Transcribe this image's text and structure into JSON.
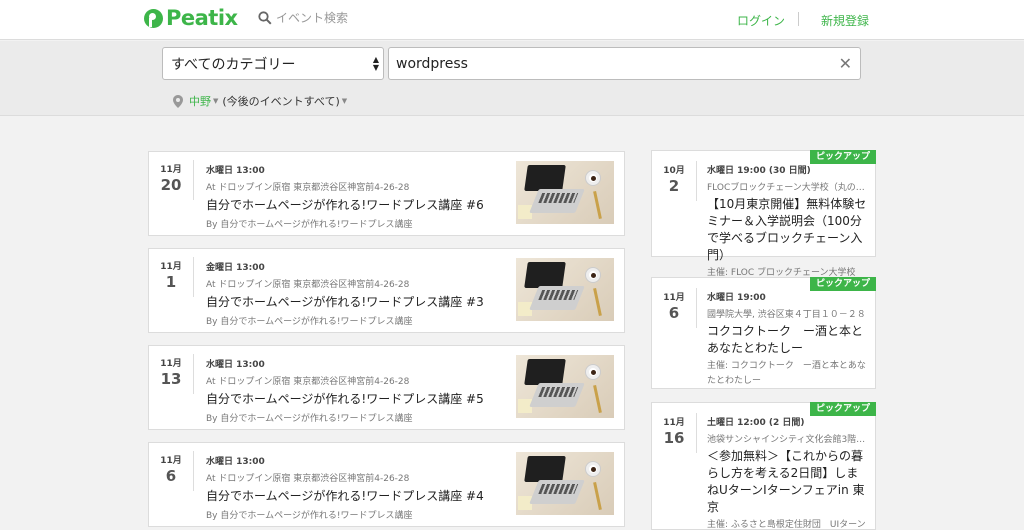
{
  "header": {
    "logo_text": "Peatix",
    "search_label": "イベント検索",
    "login": "ログイン",
    "signup": "新規登録"
  },
  "search": {
    "category": "すべてのカテゴリー",
    "keyword": "wordpress",
    "clear_icon": "close-icon",
    "location_city": "中野",
    "location_range": "(今後のイベントすべて)"
  },
  "events": [
    {
      "month": "11月",
      "day": "20",
      "time": "水曜日 13:00",
      "venue": "At ドロップイン原宿 東京都渋谷区神宮前4-26-28",
      "title": "自分でホームページが作れる!ワードプレス講座 #6",
      "organizer": "By 自分でホームページが作れる!ワードプレス講座"
    },
    {
      "month": "11月",
      "day": "1",
      "time": "金曜日 13:00",
      "venue": "At ドロップイン原宿 東京都渋谷区神宮前4-26-28",
      "title": "自分でホームページが作れる!ワードプレス講座 #3",
      "organizer": "By 自分でホームページが作れる!ワードプレス講座"
    },
    {
      "month": "11月",
      "day": "13",
      "time": "水曜日 13:00",
      "venue": "At ドロップイン原宿 東京都渋谷区神宮前4-26-28",
      "title": "自分でホームページが作れる!ワードプレス講座 #5",
      "organizer": "By 自分でホームページが作れる!ワードプレス講座"
    },
    {
      "month": "11月",
      "day": "6",
      "time": "水曜日 13:00",
      "venue": "At ドロップイン原宿 東京都渋谷区神宮前4-26-28",
      "title": "自分でホームページが作れる!ワードプレス講座 #4",
      "organizer": "By 自分でホームページが作れる!ワードプレス講座"
    }
  ],
  "pickups": [
    {
      "badge": "ピックアップ",
      "month": "10月",
      "day": "2",
      "time": "水曜日 19:00 (30 日間)",
      "venue": "FLOCブロックチェーン大学校（丸の…",
      "title": "【10月東京開催】無料体験セミナー＆入学説明会（100分で学べるブロックチェーン入門）",
      "organizer": "主催: FLOC ブロックチェーン大学校"
    },
    {
      "badge": "ピックアップ",
      "month": "11月",
      "day": "6",
      "time": "水曜日 19:00",
      "venue": "國學院大學, 渋谷区東４丁目１０－２８",
      "title": "コクコクトーク　ー酒と本とあなたとわたしー",
      "organizer": "主催: コクコクトーク　ー酒と本とあなたとわたしー"
    },
    {
      "badge": "ピックアップ",
      "month": "11月",
      "day": "16",
      "time": "土曜日 12:00 (2 日間)",
      "venue": "池袋サンシャインシティ文化会館3階…",
      "title": "＜参加無料＞【これからの暮らし方を考える2日間】しまねUターンIターンフェアin 東京",
      "organizer": "主催: ふるさと島根定住財団　UIターン推進課"
    }
  ]
}
